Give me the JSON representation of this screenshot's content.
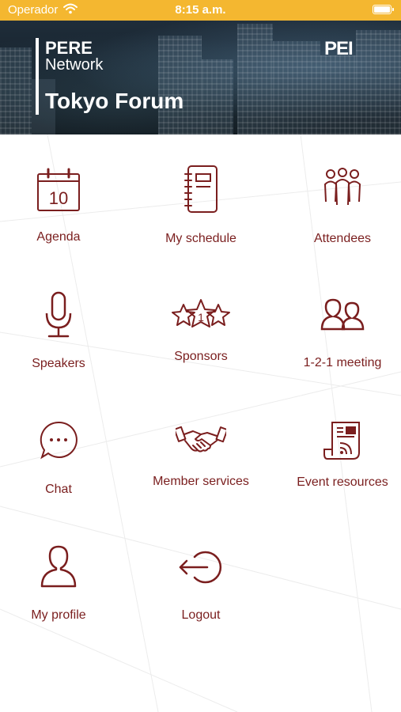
{
  "status_bar": {
    "carrier": "Operador",
    "time": "8:15 a.m."
  },
  "header": {
    "line1": "PERE",
    "line2": "Network",
    "title": "Tokyo Forum",
    "logo": "PEI"
  },
  "menu": [
    {
      "label": "Agenda",
      "icon": "calendar-icon"
    },
    {
      "label": "My schedule",
      "icon": "notebook-icon"
    },
    {
      "label": "Attendees",
      "icon": "people-icon"
    },
    {
      "label": "Speakers",
      "icon": "microphone-icon"
    },
    {
      "label": "Sponsors",
      "icon": "stars-icon"
    },
    {
      "label": "1-2-1 meeting",
      "icon": "two-people-icon"
    },
    {
      "label": "Chat",
      "icon": "chat-bubble-icon"
    },
    {
      "label": "Member services",
      "icon": "handshake-icon"
    },
    {
      "label": "Event resources",
      "icon": "newsletter-feed-icon"
    },
    {
      "label": "My profile",
      "icon": "user-icon"
    },
    {
      "label": "Logout",
      "icon": "logout-icon"
    }
  ],
  "calendar_day": "10",
  "sponsor_rank": "1",
  "colors": {
    "status_bar": "#f4b730",
    "accent": "#7a1e1e",
    "banner_dark": "#16222c"
  }
}
